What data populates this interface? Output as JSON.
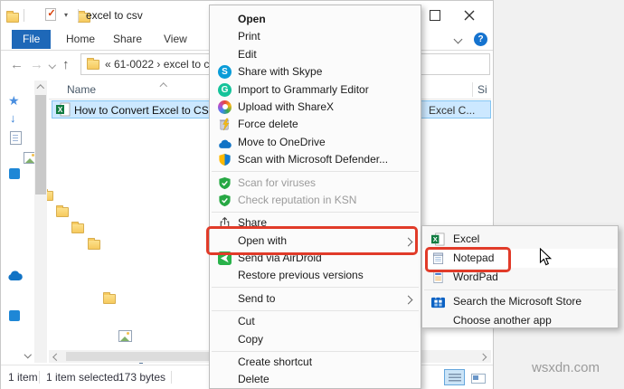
{
  "window": {
    "title": "excel to csv",
    "tabs": [
      "File",
      "Home",
      "Share",
      "View"
    ],
    "address": {
      "breadcrumb": "« 61-0022 › excel to c"
    },
    "list": {
      "columns": {
        "name": "Name",
        "size": "Si"
      },
      "file": {
        "name": "How to Convert Excel to CSV v",
        "type": "Excel C..."
      }
    },
    "status": {
      "items_count": "1 item",
      "selected": "1 item selected",
      "size": "173 bytes"
    }
  },
  "context_menu": {
    "items": [
      {
        "label": "Open",
        "icon": ""
      },
      {
        "label": "Print",
        "icon": ""
      },
      {
        "label": "Edit",
        "icon": ""
      },
      {
        "label": "Share with Skype",
        "icon": "skype-icon"
      },
      {
        "label": "Import to Grammarly Editor",
        "icon": "grammarly-icon"
      },
      {
        "label": "Upload with ShareX",
        "icon": "sharex-icon"
      },
      {
        "label": "Force delete",
        "icon": "force-delete-icon"
      },
      {
        "label": "Move to OneDrive",
        "icon": "onedrive-icon"
      },
      {
        "label": "Scan with Microsoft Defender...",
        "icon": "defender-icon"
      },
      {
        "label": "Scan for viruses",
        "icon": "antivirus-shield-icon"
      },
      {
        "label": "Check reputation in KSN",
        "icon": "antivirus-shield-icon"
      },
      {
        "label": "Share",
        "icon": "share-icon"
      },
      {
        "label": "Open with",
        "icon": ""
      },
      {
        "label": "Send via AirDroid",
        "icon": "airdroid-icon"
      },
      {
        "label": "Restore previous versions",
        "icon": ""
      },
      {
        "label": "Send to",
        "icon": ""
      },
      {
        "label": "Cut",
        "icon": ""
      },
      {
        "label": "Copy",
        "icon": ""
      },
      {
        "label": "Create shortcut",
        "icon": ""
      },
      {
        "label": "Delete",
        "icon": ""
      }
    ],
    "letters": {
      "skype": "S",
      "grammarly": "G"
    }
  },
  "submenu": {
    "items": [
      {
        "label": "Excel",
        "icon": "excel-icon"
      },
      {
        "label": "Notepad",
        "icon": "notepad-icon"
      },
      {
        "label": "WordPad",
        "icon": "wordpad-icon"
      },
      {
        "label": "Search the Microsoft Store",
        "icon": "microsoft-store-icon"
      },
      {
        "label": "Choose another app",
        "icon": ""
      }
    ]
  },
  "watermark": "wsxdn.com",
  "colors": {
    "accent_blue": "#1e68b8",
    "selection": "#cce8ff",
    "annotation_red": "#e13b29"
  }
}
